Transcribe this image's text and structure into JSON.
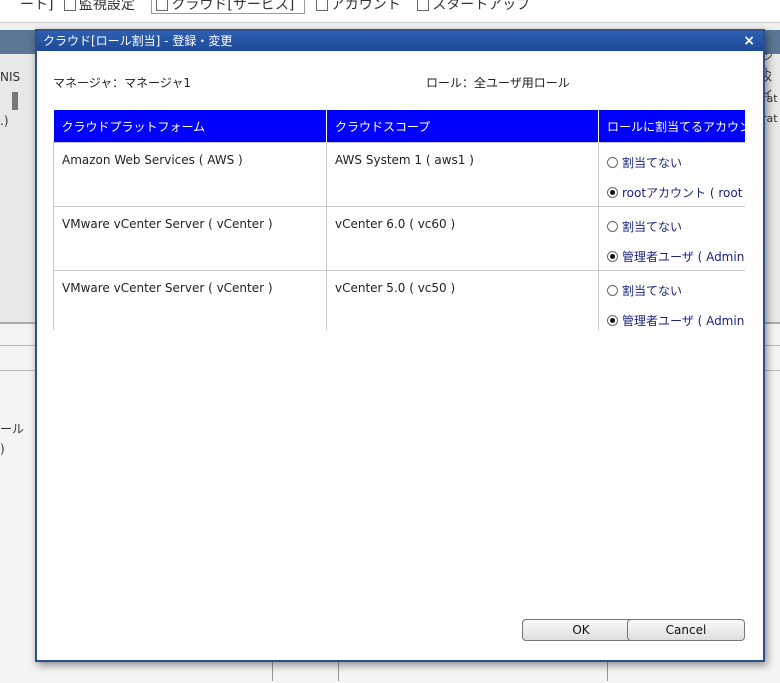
{
  "background": {
    "tabs": [
      "ート]",
      "監視設定",
      "クラウド[サービス]",
      "アカウント",
      "スタートアップ"
    ],
    "left_texts": [
      "NIS",
      ".)",
      "ール",
      ")"
    ],
    "right_texts": [
      "ント",
      "メイ",
      "rat",
      "rat"
    ]
  },
  "dialog": {
    "title": "クラウド[ロール割当] - 登録・変更",
    "close_label": "×",
    "manager_label": "マネージャ：マネージャ1",
    "role_label": "ロール：全ユーザ用ロール",
    "columns": [
      "クラウドプラットフォーム",
      "クラウドスコープ",
      "ロールに割当てるアカウント"
    ],
    "rows": [
      {
        "platform": "Amazon Web Services ( AWS )",
        "scope": "AWS System 1 ( aws1 )",
        "options": [
          {
            "label": "割当てない",
            "selected": false
          },
          {
            "label": "rootアカウント ( root )",
            "selected": true
          }
        ]
      },
      {
        "platform": "VMware vCenter Server ( vCenter )",
        "scope": "vCenter 6.0 ( vc60 )",
        "options": [
          {
            "label": "割当てない",
            "selected": false
          },
          {
            "label": "管理者ユーザ ( Admin )",
            "selected": true
          }
        ]
      },
      {
        "platform": "VMware vCenter Server ( vCenter )",
        "scope": "vCenter 5.0 ( vc50 )",
        "options": [
          {
            "label": "割当てない",
            "selected": false
          },
          {
            "label": "管理者ユーザ ( Admin )",
            "selected": true
          }
        ]
      }
    ],
    "ok_label": "OK",
    "cancel_label": "Cancel"
  },
  "colors": {
    "header_bg": "#0000ff",
    "title_bar": "#1d4a99",
    "radio_label": "#1a237e"
  }
}
